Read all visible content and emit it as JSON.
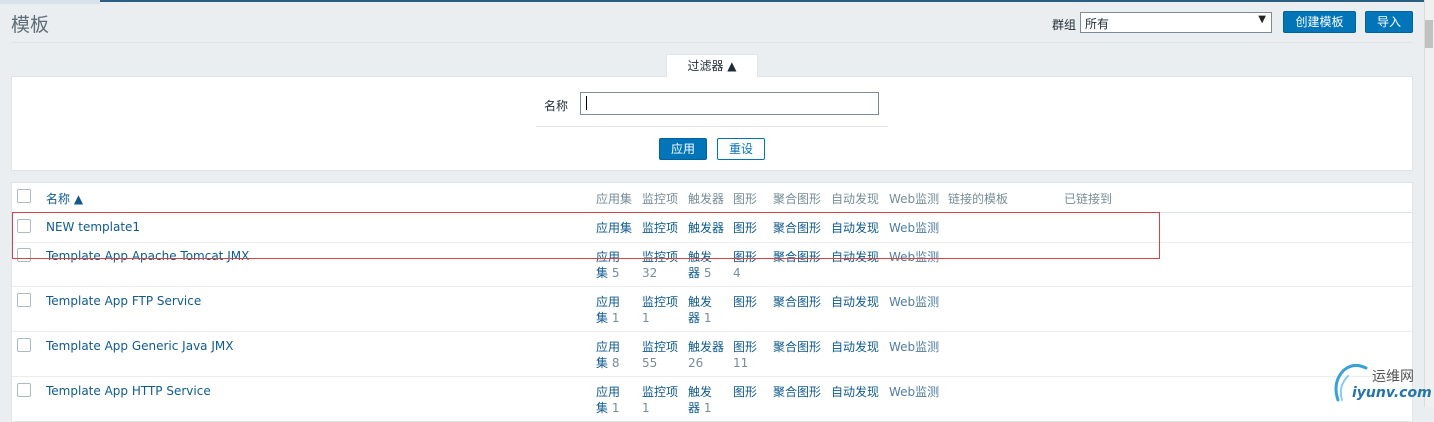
{
  "header": {
    "title": "模板",
    "group_label": "群组",
    "group_selected": "所有",
    "create_button": "创建模板",
    "import_button": "导入"
  },
  "filter": {
    "tab_label": "过滤器 ▲",
    "name_label": "名称",
    "name_value": "",
    "apply_button": "应用",
    "reset_button": "重设"
  },
  "table": {
    "columns": {
      "name": "名称 ▲",
      "applications": "应用集",
      "items": "监控项",
      "triggers": "触发器",
      "graphs": "图形",
      "screens": "聚合图形",
      "discovery": "自动发现",
      "web": "Web监测",
      "linked_templates": "链接的模板",
      "linked_to": "已链接到"
    },
    "rows": [
      {
        "name": "NEW template1",
        "app": "应用集",
        "app_count": "",
        "items": "监控项",
        "items_count": "",
        "triggers": "触发器",
        "triggers_count": "",
        "graphs": "图形",
        "graphs_count": "",
        "screens": "聚合图形",
        "discovery": "自动发现",
        "web": "Web监测"
      },
      {
        "name": "Template App Apache Tomcat JMX",
        "app": "应用集",
        "app_count": "5",
        "items": "监控项",
        "items_count": "32",
        "triggers": "触发器",
        "triggers_count": "5",
        "graphs": "图形",
        "graphs_count": "4",
        "screens": "聚合图形",
        "discovery": "自动发现",
        "web": "Web监测"
      },
      {
        "name": "Template App FTP Service",
        "app": "应用集",
        "app_count": "1",
        "items": "监控项",
        "items_count": "1",
        "triggers": "触发器",
        "triggers_count": "1",
        "graphs": "图形",
        "graphs_count": "",
        "screens": "聚合图形",
        "discovery": "自动发现",
        "web": "Web监测"
      },
      {
        "name": "Template App Generic Java JMX",
        "app": "应用集",
        "app_count": "8",
        "items": "监控项",
        "items_count": "55",
        "triggers": "触发器",
        "triggers_count": "26",
        "graphs": "图形",
        "graphs_count": "11",
        "screens": "聚合图形",
        "discovery": "自动发现",
        "web": "Web监测"
      },
      {
        "name": "Template App HTTP Service",
        "app": "应用集",
        "app_count": "1",
        "items": "监控项",
        "items_count": "1",
        "triggers": "触发器",
        "triggers_count": "1",
        "graphs": "图形",
        "graphs_count": "",
        "screens": "聚合图形",
        "discovery": "自动发现",
        "web": "Web监测"
      }
    ]
  },
  "watermark": {
    "text": "运维网",
    "url": "iyunv.com"
  },
  "colors": {
    "primary": "#0275b8",
    "link": "#0f5a8f",
    "highlight": "#d64545"
  }
}
